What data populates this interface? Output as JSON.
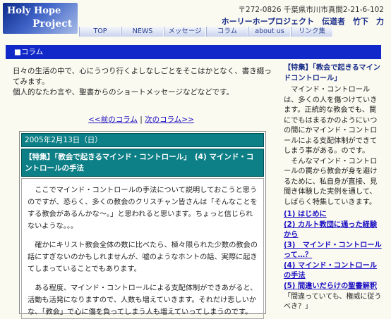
{
  "header": {
    "logo_line1": "Holy Hope",
    "logo_line2": "Project",
    "address": "〒272-0826 千葉県市川市真間2-21-6-102",
    "org": "ホーリーホープロジェクト　伝道者　竹下　力"
  },
  "nav": [
    "TOP",
    "NEWS",
    "メッセージ",
    "コラム",
    "about us",
    "リンク集"
  ],
  "section_bar": "■コラム",
  "intro": {
    "line1": "日々の生活の中で、心にうつり行くよしなしごとをそこはかとなく、書き綴ってみます。",
    "line2": "個人的なたわ言や、聖書からのショートメッセージなどなどです。"
  },
  "pager": {
    "prev": "<<前のコラム",
    "sep": " | ",
    "next": "次のコラム>>"
  },
  "post": {
    "date": "2005年2月13日（日）",
    "title": "【特集】「教会で起きるマインド・コントロール」　(4) マインド・コントロールの手法",
    "p1": "ここでマインド・コントロールの手法について説明しておこうと思うのですが、恐らく、多くの教会のクリスチャン皆さんは「そんなことをする教会があるんかな～。」と思われると思います。ちょっと信じられないような。。。",
    "p2": "確かにキリスト教会全体の数に比べたら、極々限られた少数の教会の話にすぎないのかもしれませんが、嘘のようなホントの話、実際に起きてしまっていることでもあります。",
    "p3": "ある程度、マインド・コントロールによる支配体制ができあがると、活動も活発になりますので、人数も増えていきます。それだけ悲しいかな、「教会」で心に傷を負ってしまう人も増えていってしまうのです。"
  },
  "sidebar": {
    "title": "【特集】「教会で起きるマインドコントロール」",
    "p1": "マインド・コントロールは、多くの人を傷つけていきます。正統的な教会でも、罠にでもはまるかのようにいつの間にかマインド・コントロールによる支配体制ができてしまう事がある。のです。",
    "p2": "そんなマインド・コントロールの罠から教会が身を避けるために、私自身が直接、見聞き体験した実例を通して、しばらく特集していきます。",
    "toc": [
      "(1) はじめに",
      "(2) カルト教団に通った経験から",
      "(3)　マインド・コントロールって…？",
      "(4) マインド・コントロールの手法",
      "(5) 間違いだらけの聖書解釈"
    ],
    "toc_sub": "「間違っていても、権威に従うべき？」"
  }
}
